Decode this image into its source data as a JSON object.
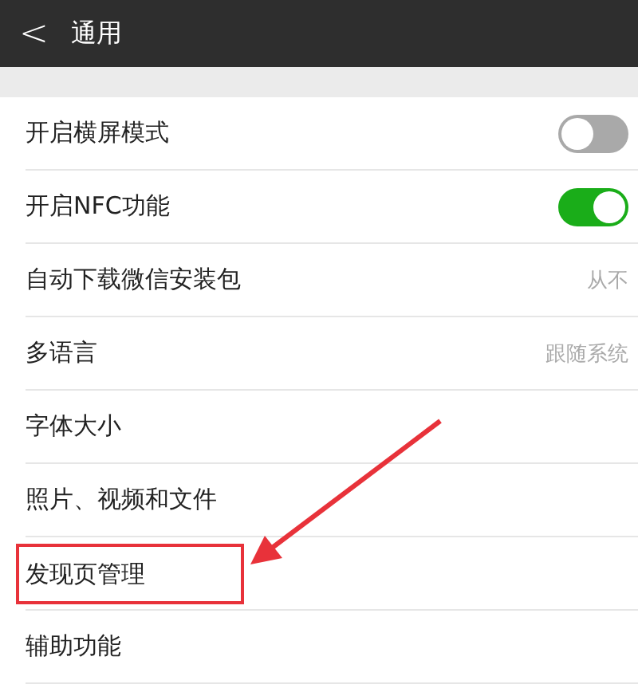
{
  "header": {
    "back_icon": "<",
    "title": "通用"
  },
  "settings": [
    {
      "kind": "toggle",
      "label": "开启横屏模式",
      "on": false,
      "highlighted": false
    },
    {
      "kind": "toggle",
      "label": "开启NFC功能",
      "on": true,
      "highlighted": false
    },
    {
      "kind": "value",
      "label": "自动下载微信安装包",
      "value": "从不",
      "highlighted": false
    },
    {
      "kind": "value",
      "label": "多语言",
      "value": "跟随系统",
      "highlighted": false
    },
    {
      "kind": "plain",
      "label": "字体大小",
      "highlighted": false
    },
    {
      "kind": "plain",
      "label": "照片、视频和文件",
      "highlighted": false
    },
    {
      "kind": "plain",
      "label": "发现页管理",
      "highlighted": true
    },
    {
      "kind": "plain",
      "label": "辅助功能",
      "highlighted": false
    }
  ]
}
